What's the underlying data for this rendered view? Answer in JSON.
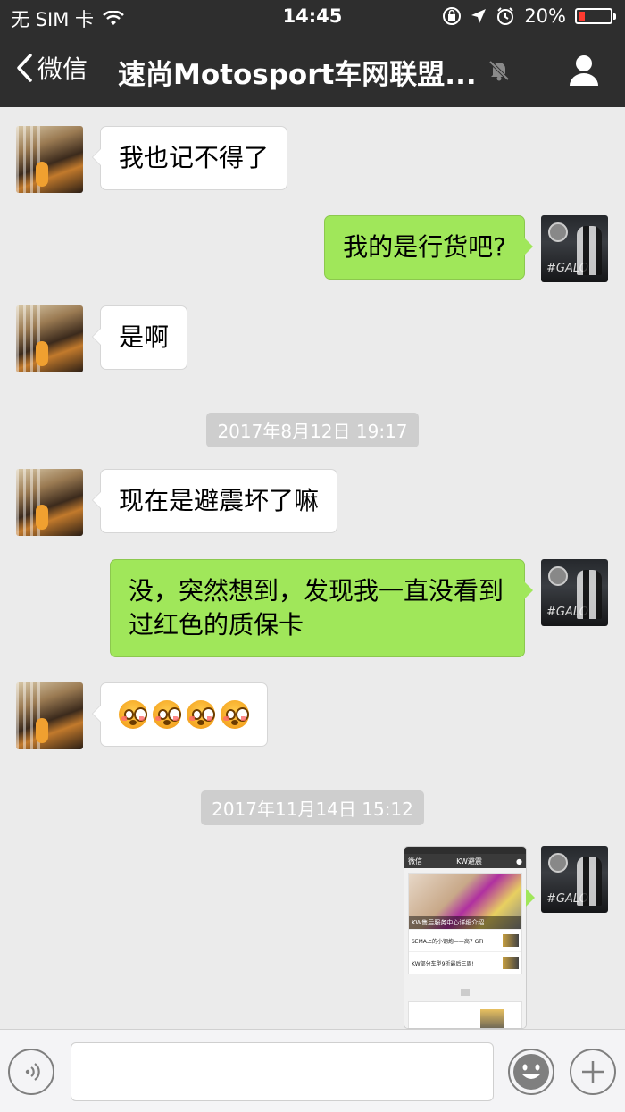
{
  "status_bar": {
    "carrier": "无 SIM 卡",
    "time": "14:45",
    "battery": "20%",
    "battery_level": 0.2,
    "battery_color": "#ff3b30"
  },
  "nav": {
    "back_label": "微信",
    "title": "速尚Motosport车网联盟...",
    "icons": [
      "chevron-left-icon",
      "mute-bell-icon",
      "profile-icon"
    ]
  },
  "messages": [
    {
      "from": "friend",
      "text": "我也记不得了"
    },
    {
      "from": "self",
      "text": "我的是行货吧?"
    },
    {
      "from": "friend",
      "text": "是啊"
    },
    {
      "type": "time",
      "text": "2017年8月12日 19:17"
    },
    {
      "from": "friend",
      "text": "现在是避震坏了嘛"
    },
    {
      "from": "self",
      "text": "没，突然想到，发现我一直没看到过红色的质保卡"
    },
    {
      "from": "friend",
      "type": "emoji",
      "count": 4
    },
    {
      "type": "time",
      "text": "2017年11月14日 15:12"
    },
    {
      "from": "self",
      "type": "image"
    }
  ],
  "shared_image": {
    "back": "微信",
    "title": "KW避震",
    "hero_caption": "KW售后服务中心详细介绍",
    "rows": [
      "SEMA上的小钢炮——高7 GTI",
      "KW部分车型9折最后三周!"
    ]
  },
  "self_avatar_tag": "#GALO",
  "colors": {
    "nav_bg": "#2e2e2e",
    "chat_bg": "#ebebeb",
    "self_bubble": "#a0e75a",
    "friend_bubble": "#ffffff",
    "timestamp_bg": "#cecece"
  }
}
